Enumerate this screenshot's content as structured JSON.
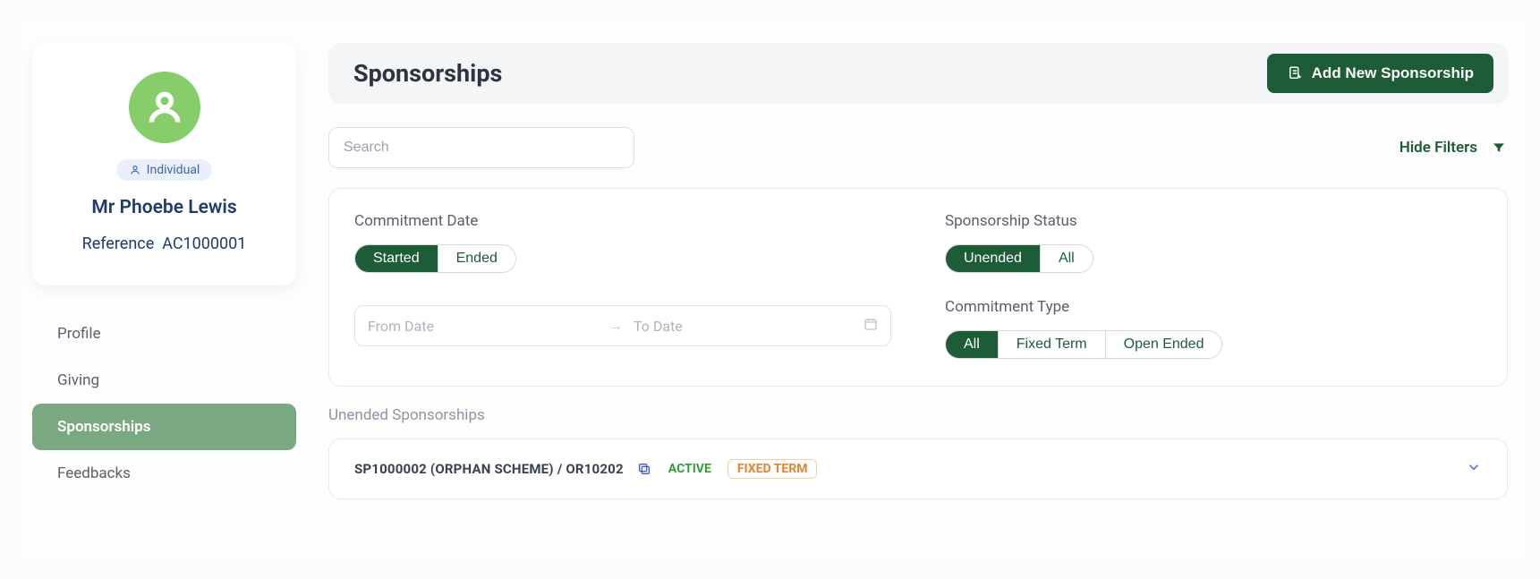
{
  "sidebar": {
    "badge_label": "Individual",
    "name": "Mr Phoebe Lewis",
    "reference_label": "Reference",
    "reference_value": "AC1000001",
    "nav": [
      {
        "label": "Profile",
        "active": false
      },
      {
        "label": "Giving",
        "active": false
      },
      {
        "label": "Sponsorships",
        "active": true
      },
      {
        "label": "Feedbacks",
        "active": false
      }
    ]
  },
  "header": {
    "title": "Sponsorships",
    "add_button": "Add New Sponsorship"
  },
  "toolbar": {
    "search_placeholder": "Search",
    "hide_filters": "Hide Filters"
  },
  "filters": {
    "commitment_date": {
      "label": "Commitment Date",
      "options": [
        "Started",
        "Ended"
      ],
      "selected": "Started",
      "from_placeholder": "From Date",
      "to_placeholder": "To Date"
    },
    "sponsorship_status": {
      "label": "Sponsorship Status",
      "options": [
        "Unended",
        "All"
      ],
      "selected": "Unended"
    },
    "commitment_type": {
      "label": "Commitment Type",
      "options": [
        "All",
        "Fixed Term",
        "Open Ended"
      ],
      "selected": "All"
    }
  },
  "list": {
    "section_label": "Unended Sponsorships",
    "items": [
      {
        "title": "SP1000002 (ORPHAN SCHEME) / OR10202",
        "status": "ACTIVE",
        "term": "FIXED TERM"
      }
    ]
  }
}
